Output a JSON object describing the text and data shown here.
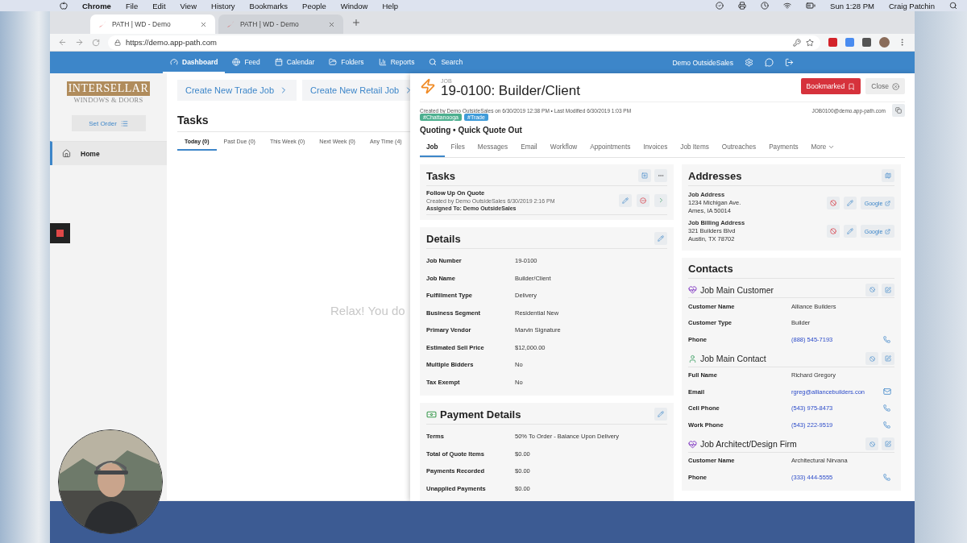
{
  "menubar": {
    "app": "Chrome",
    "menus": [
      "File",
      "Edit",
      "View",
      "History",
      "Bookmarks",
      "People",
      "Window",
      "Help"
    ],
    "clock": "Sun 1:28 PM",
    "user": "Craig Patchin"
  },
  "browser": {
    "tabs": [
      {
        "title": "PATH | WD - Demo",
        "selected": true
      },
      {
        "title": "PATH | WD - Demo",
        "selected": false
      }
    ],
    "url": "https://demo.app-path.com"
  },
  "nav": {
    "items": [
      {
        "label": "Dashboard",
        "selected": true
      },
      {
        "label": "Feed",
        "selected": false
      },
      {
        "label": "Calendar",
        "selected": false
      },
      {
        "label": "Folders",
        "selected": false
      },
      {
        "label": "Reports",
        "selected": false
      },
      {
        "label": "Search",
        "selected": false
      }
    ],
    "user": "Demo OutsideSales"
  },
  "sidebar": {
    "logo": {
      "name": "INTERSELLAR",
      "tagline": "WINDOWS & DOORS"
    },
    "set_order": "Set Order",
    "items": [
      {
        "label": "Home",
        "selected": true
      }
    ]
  },
  "dashboard": {
    "actions": [
      "Create New Trade Job",
      "Create New Retail Job"
    ],
    "tasks_title": "Tasks",
    "tabs": [
      {
        "label": "Today (0)",
        "selected": true
      },
      {
        "label": "Past Due (0)",
        "selected": false
      },
      {
        "label": "This Week (0)",
        "selected": false
      },
      {
        "label": "Next Week (0)",
        "selected": false
      },
      {
        "label": "Any Time (4)",
        "selected": false
      }
    ],
    "empty": "Relax! You do"
  },
  "job": {
    "kicker": "JOB",
    "title": "19-0100: Builder/Client",
    "meta": "Created by Demo OutsideSales on 6/30/2019 12:38 PM • Last Modified 6/30/2019 1:03 PM",
    "email": "JOB0100@demo.app-path.com",
    "bookmark": "Bookmarked",
    "close": "Close",
    "tags": [
      {
        "label": "#Chattanooga",
        "color": "#4daf8f"
      },
      {
        "label": "#Trade",
        "color": "#3f9bd8"
      }
    ],
    "status": "Quoting • Quick Quote Out",
    "tabs": [
      {
        "label": "Job",
        "selected": true
      },
      {
        "label": "Files",
        "selected": false
      },
      {
        "label": "Messages",
        "selected": false
      },
      {
        "label": "Email",
        "selected": false
      },
      {
        "label": "Workflow",
        "selected": false
      },
      {
        "label": "Appointments",
        "selected": false
      },
      {
        "label": "Invoices",
        "selected": false
      },
      {
        "label": "Job Items",
        "selected": false
      },
      {
        "label": "Outreaches",
        "selected": false
      },
      {
        "label": "Payments",
        "selected": false
      }
    ],
    "more": "More",
    "tasks": {
      "title": "Tasks",
      "items": [
        {
          "title": "Follow Up On Quote",
          "meta": "Created by Demo OutsideSales 6/30/2019 2:16 PM",
          "assigned": "Assigned To: Demo OutsideSales"
        }
      ]
    },
    "details": {
      "title": "Details",
      "rows": [
        {
          "label": "Job Number",
          "value": "19-0100"
        },
        {
          "label": "Job Name",
          "value": "Builder/Client"
        },
        {
          "label": "Fulfillment Type",
          "value": "Delivery"
        },
        {
          "label": "Business Segment",
          "value": "Residential New"
        },
        {
          "label": "Primary Vendor",
          "value": "Marvin Signature"
        },
        {
          "label": "Estimated Sell Price",
          "value": "$12,000.00"
        },
        {
          "label": "Multiple Bidders",
          "value": "No"
        },
        {
          "label": "Tax Exempt",
          "value": "No"
        }
      ]
    },
    "payment": {
      "title": "Payment Details",
      "rows": [
        {
          "label": "Terms",
          "value": "50% To Order - Balance Upon Delivery"
        },
        {
          "label": "Total of Quote Items",
          "value": "$0.00"
        },
        {
          "label": "Payments Recorded",
          "value": "$0.00"
        },
        {
          "label": "Unapplied Payments",
          "value": "$0.00"
        }
      ]
    },
    "addresses": {
      "title": "Addresses",
      "items": [
        {
          "label": "Job Address",
          "lines": [
            "1234 Michigan Ave.",
            "Ames, IA 50014"
          ],
          "link": "Google"
        },
        {
          "label": "Job Billing Address",
          "lines": [
            "321 Builders Blvd",
            "Austin, TX 78702"
          ],
          "link": "Google"
        }
      ]
    },
    "contacts": {
      "title": "Contacts",
      "groups": [
        {
          "title": "Job Main Customer",
          "kind": "company",
          "rows": [
            {
              "label": "Customer Name",
              "value": "Alliance Builders",
              "kind": "text"
            },
            {
              "label": "Customer Type",
              "value": "Builder",
              "kind": "text"
            },
            {
              "label": "Phone",
              "value": "(888) 545-7193",
              "kind": "phone"
            }
          ]
        },
        {
          "title": "Job Main Contact",
          "kind": "person",
          "rows": [
            {
              "label": "Full Name",
              "value": "Richard Gregory",
              "kind": "text"
            },
            {
              "label": "Email",
              "value": "rgreg@alliancebuilders.con",
              "kind": "email"
            },
            {
              "label": "Cell Phone",
              "value": "(543) 975-8473",
              "kind": "phone"
            },
            {
              "label": "Work Phone",
              "value": "(543) 222-9519",
              "kind": "phone"
            }
          ]
        },
        {
          "title": "Job Architect/Design Firm",
          "kind": "company",
          "rows": [
            {
              "label": "Customer Name",
              "value": "Architectural Nirvana",
              "kind": "text"
            },
            {
              "label": "Phone",
              "value": "(333) 444-5555",
              "kind": "phone"
            }
          ]
        }
      ]
    }
  }
}
